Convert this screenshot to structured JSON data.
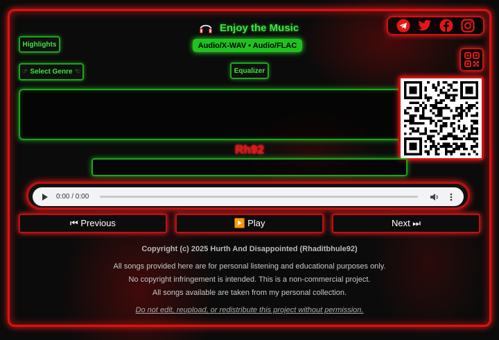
{
  "header": {
    "title": "Enjoy the Music",
    "title_icon": "headphones-icon",
    "formats": "Audio/X-WAV • Audio/FLAC"
  },
  "social": [
    "telegram-icon",
    "twitter-icon",
    "facebook-icon",
    "instagram-icon"
  ],
  "controls": {
    "highlights_label": "Highlights",
    "genre_label": "☞ Select Genre ☜",
    "equalizer_label": "Equalizer"
  },
  "artist_tag": "Rh92",
  "player": {
    "time": "0:00 / 0:00",
    "progress": 0
  },
  "nav": {
    "previous_label": "⏮ Previous",
    "play_label": "▶️ Play",
    "next_label": "Next ⏭"
  },
  "footer": {
    "copyright": "Copyright (c) 2025 Hurth And Disappointed (Rhaditbhule92)",
    "line1": "All songs provided here are for personal listening and educational purposes only.",
    "line2": "No copyright infringement is intended. This is a non-commercial project.",
    "line3": "All songs available are taken from my personal collection.",
    "warning": "Do not edit, reupload, or redistribute this project without permission."
  },
  "colors": {
    "accent_green": "#1fc21f",
    "accent_red": "#e01010",
    "background": "#0a0a0a"
  }
}
